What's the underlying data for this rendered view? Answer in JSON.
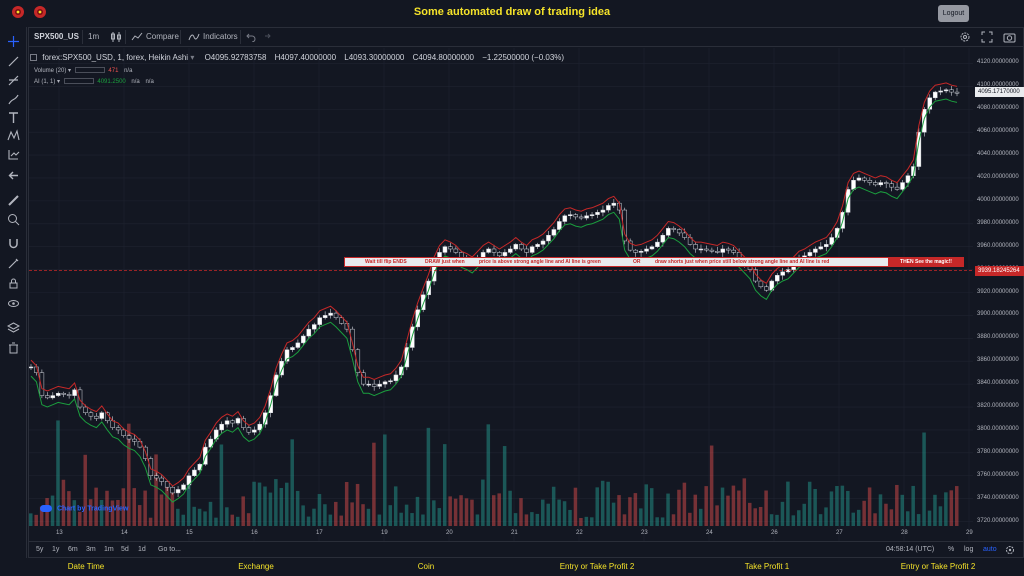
{
  "app": {
    "title": "Some automated draw of trading idea",
    "logout_label": "Logout"
  },
  "toolbar": {
    "symbol": "SPX500_US",
    "interval": "1m",
    "compare_label": "Compare",
    "indicators_label": "Indicators"
  },
  "legend": {
    "series_title": "forex:SPX500_USD, 1, forex, Heikin Ashi",
    "open": "O4095.92783758",
    "high": "H4097.40000000",
    "low": "L4093.30000000",
    "close": "C4094.80000000",
    "change": "−1.22500000 (−0.03%)",
    "volume_label": "Volume (20)",
    "volume_value": "471",
    "volume_ma": "n/a",
    "ai_label": "AI (1, 1)",
    "ai_value": "4091.2500",
    "ai_v2": "n/a",
    "ai_v3": "n/a"
  },
  "price_axis": {
    "labels": [
      "4120.00000000",
      "4100.00000000",
      "4080.00000000",
      "4060.00000000",
      "4040.00000000",
      "4020.00000000",
      "4000.00000000",
      "3980.00000000",
      "3960.00000000",
      "3940.00000000",
      "3920.00000000",
      "3900.00000000",
      "3880.00000000",
      "3860.00000000",
      "3840.00000000",
      "3820.00000000",
      "3800.00000000",
      "3780.00000000",
      "3760.00000000",
      "3740.00000000",
      "3720.00000000"
    ],
    "current_price": "4095.17170000",
    "line_price": "3939.18245264"
  },
  "time_axis": {
    "labels": [
      "13",
      "14",
      "15",
      "16",
      "17",
      "19",
      "20",
      "21",
      "22",
      "23",
      "24",
      "26",
      "27",
      "28",
      "29"
    ]
  },
  "banner": {
    "text1": "Wait till flip ENDS",
    "text2": "DRAW just when",
    "text3": "price is above strong angle line and AI line is green",
    "text4": "OR",
    "text5": "draw shorts just when price still below strong angle line and AI line is red",
    "magic": "THEN See the magic!!"
  },
  "bottom": {
    "ranges": [
      "5y",
      "1y",
      "6m",
      "3m",
      "1m",
      "5d",
      "1d"
    ],
    "goto": "Go to...",
    "clock": "04:58:14 (UTC)",
    "percent": "%",
    "log": "log",
    "auto": "auto"
  },
  "watermark": "Chart by TradingView",
  "footer": {
    "labels": [
      "Date Time",
      "Exchange",
      "Coin",
      "Entry or Take Profit 2",
      "Take Profit 1",
      "Entry or Take Profit 2"
    ]
  },
  "colors": {
    "background": "#131722",
    "title_yellow": "#f5e32a",
    "bull_green": "#26a69a",
    "bear_red": "#ef5350",
    "ai_green": "#1b9e3e",
    "ai_red": "#c62828"
  },
  "chart_data": {
    "type": "candlestick",
    "chart_style": "Heikin Ashi",
    "ylim": [
      3710,
      4130
    ],
    "x_ticks": [
      "13",
      "14",
      "15",
      "16",
      "17",
      "19",
      "20",
      "21",
      "22",
      "23",
      "24",
      "26",
      "27",
      "28",
      "29"
    ],
    "close_path": [
      3855,
      3850,
      3830,
      3828,
      3830,
      3832,
      3831,
      3830,
      3835,
      3820,
      3815,
      3812,
      3810,
      3815,
      3808,
      3802,
      3800,
      3795,
      3792,
      3790,
      3785,
      3775,
      3760,
      3758,
      3755,
      3750,
      3745,
      3748,
      3752,
      3760,
      3765,
      3770,
      3785,
      3792,
      3800,
      3805,
      3808,
      3806,
      3810,
      3802,
      3798,
      3800,
      3805,
      3815,
      3830,
      3848,
      3860,
      3870,
      3872,
      3876,
      3882,
      3888,
      3892,
      3898,
      3900,
      3902,
      3898,
      3893,
      3888,
      3870,
      3850,
      3840,
      3840,
      3838,
      3840,
      3842,
      3843,
      3848,
      3855,
      3872,
      3890,
      3905,
      3918,
      3930,
      3945,
      3955,
      3960,
      3958,
      3955,
      3950,
      3948,
      3945,
      3950,
      3955,
      3958,
      3955,
      3952,
      3955,
      3958,
      3962,
      3958,
      3955,
      3960,
      3962,
      3965,
      3970,
      3975,
      3982,
      3987,
      3988,
      3986,
      3985,
      3987,
      3988,
      3990,
      3992,
      3996,
      3998,
      3992,
      3965,
      3957,
      3955,
      3956,
      3958,
      3960,
      3964,
      3970,
      3976,
      3975,
      3972,
      3968,
      3962,
      3958,
      3958,
      3957,
      3956,
      3955,
      3958,
      3957,
      3955,
      3950,
      3945,
      3940,
      3930,
      3925,
      3922,
      3930,
      3935,
      3938,
      3940,
      3945,
      3950,
      3952,
      3955,
      3958,
      3960,
      3962,
      3968,
      3976,
      3990,
      4010,
      4018,
      4020,
      4018,
      4016,
      4014,
      4016,
      4015,
      4012,
      4010,
      4016,
      4022,
      4030,
      4060,
      4080,
      4090,
      4095,
      4096,
      4097,
      4095,
      4094
    ]
  }
}
